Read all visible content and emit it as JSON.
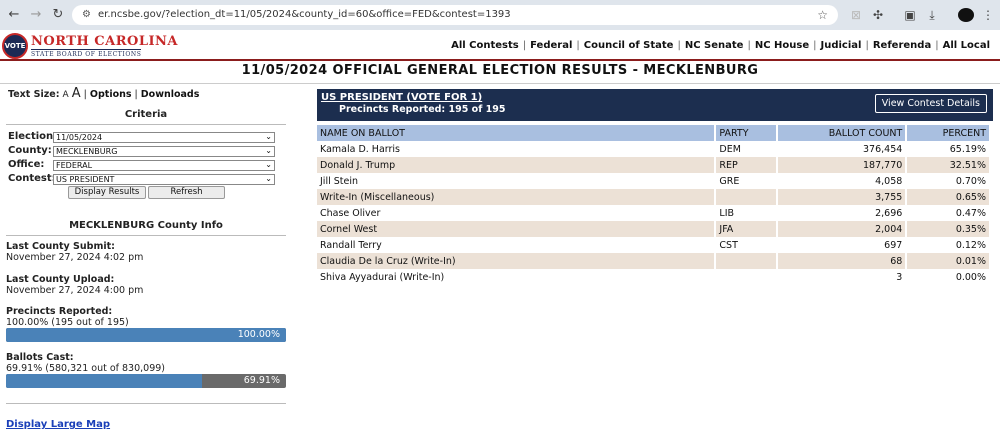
{
  "browser": {
    "url": "er.ncsbe.gov/?election_dt=11/05/2024&county_id=60&office=FED&contest=1393"
  },
  "logo": {
    "seal_text": "VOTE",
    "title": "NORTH CAROLINA",
    "subtitle": "STATE BOARD OF ELECTIONS"
  },
  "topnav": [
    "All Contests",
    "Federal",
    "Council of State",
    "NC Senate",
    "NC House",
    "Judicial",
    "Referenda",
    "All Local"
  ],
  "page_title": "11/05/2024 OFFICIAL GENERAL ELECTION RESULTS - MECKLENBURG",
  "textsize": {
    "label": "Text Size:",
    "small": "A",
    "large": "A",
    "options": "Options",
    "downloads": "Downloads"
  },
  "criteria": {
    "heading": "Criteria",
    "election_label": "Election:",
    "election_value": "11/05/2024",
    "county_label": "County:",
    "county_value": "MECKLENBURG",
    "office_label": "Office:",
    "office_value": "FEDERAL",
    "contest_label": "Contest:",
    "contest_value": "US PRESIDENT",
    "display_button": "Display Results",
    "refresh_button": "Refresh"
  },
  "county_info": {
    "heading": "MECKLENBURG County Info",
    "last_submit_label": "Last County Submit:",
    "last_submit_value": "November 27, 2024 4:02 pm",
    "last_upload_label": "Last County Upload:",
    "last_upload_value": "November 27, 2024 4:00 pm",
    "precincts_label": "Precincts Reported:",
    "precincts_value": "100.00% (195 out of 195)",
    "precincts_pct": 100.0,
    "precincts_pct_text": "100.00%",
    "ballots_label": "Ballots Cast:",
    "ballots_value": "69.91% (580,321 out of 830,099)",
    "ballots_pct": 69.91,
    "ballots_pct_text": "69.91%",
    "map_link": "Display Large Map"
  },
  "contest": {
    "title": "US PRESIDENT (VOTE FOR 1)",
    "precincts": "Precincts Reported: 195 of 195",
    "details_button": "View Contest Details",
    "columns": [
      "NAME ON BALLOT",
      "PARTY",
      "BALLOT COUNT",
      "PERCENT"
    ],
    "rows": [
      {
        "name": "Kamala D. Harris",
        "party": "DEM",
        "count": "376,454",
        "percent": "65.19%"
      },
      {
        "name": "Donald J. Trump",
        "party": "REP",
        "count": "187,770",
        "percent": "32.51%"
      },
      {
        "name": "Jill Stein",
        "party": "GRE",
        "count": "4,058",
        "percent": "0.70%"
      },
      {
        "name": "Write-In (Miscellaneous)",
        "party": "",
        "count": "3,755",
        "percent": "0.65%"
      },
      {
        "name": "Chase Oliver",
        "party": "LIB",
        "count": "2,696",
        "percent": "0.47%"
      },
      {
        "name": "Cornel West",
        "party": "JFA",
        "count": "2,004",
        "percent": "0.35%"
      },
      {
        "name": "Randall Terry",
        "party": "CST",
        "count": "697",
        "percent": "0.12%"
      },
      {
        "name": "Claudia De la Cruz (Write-In)",
        "party": "",
        "count": "68",
        "percent": "0.01%"
      },
      {
        "name": "Shiva Ayyadurai (Write-In)",
        "party": "",
        "count": "3",
        "percent": "0.00%"
      }
    ]
  }
}
